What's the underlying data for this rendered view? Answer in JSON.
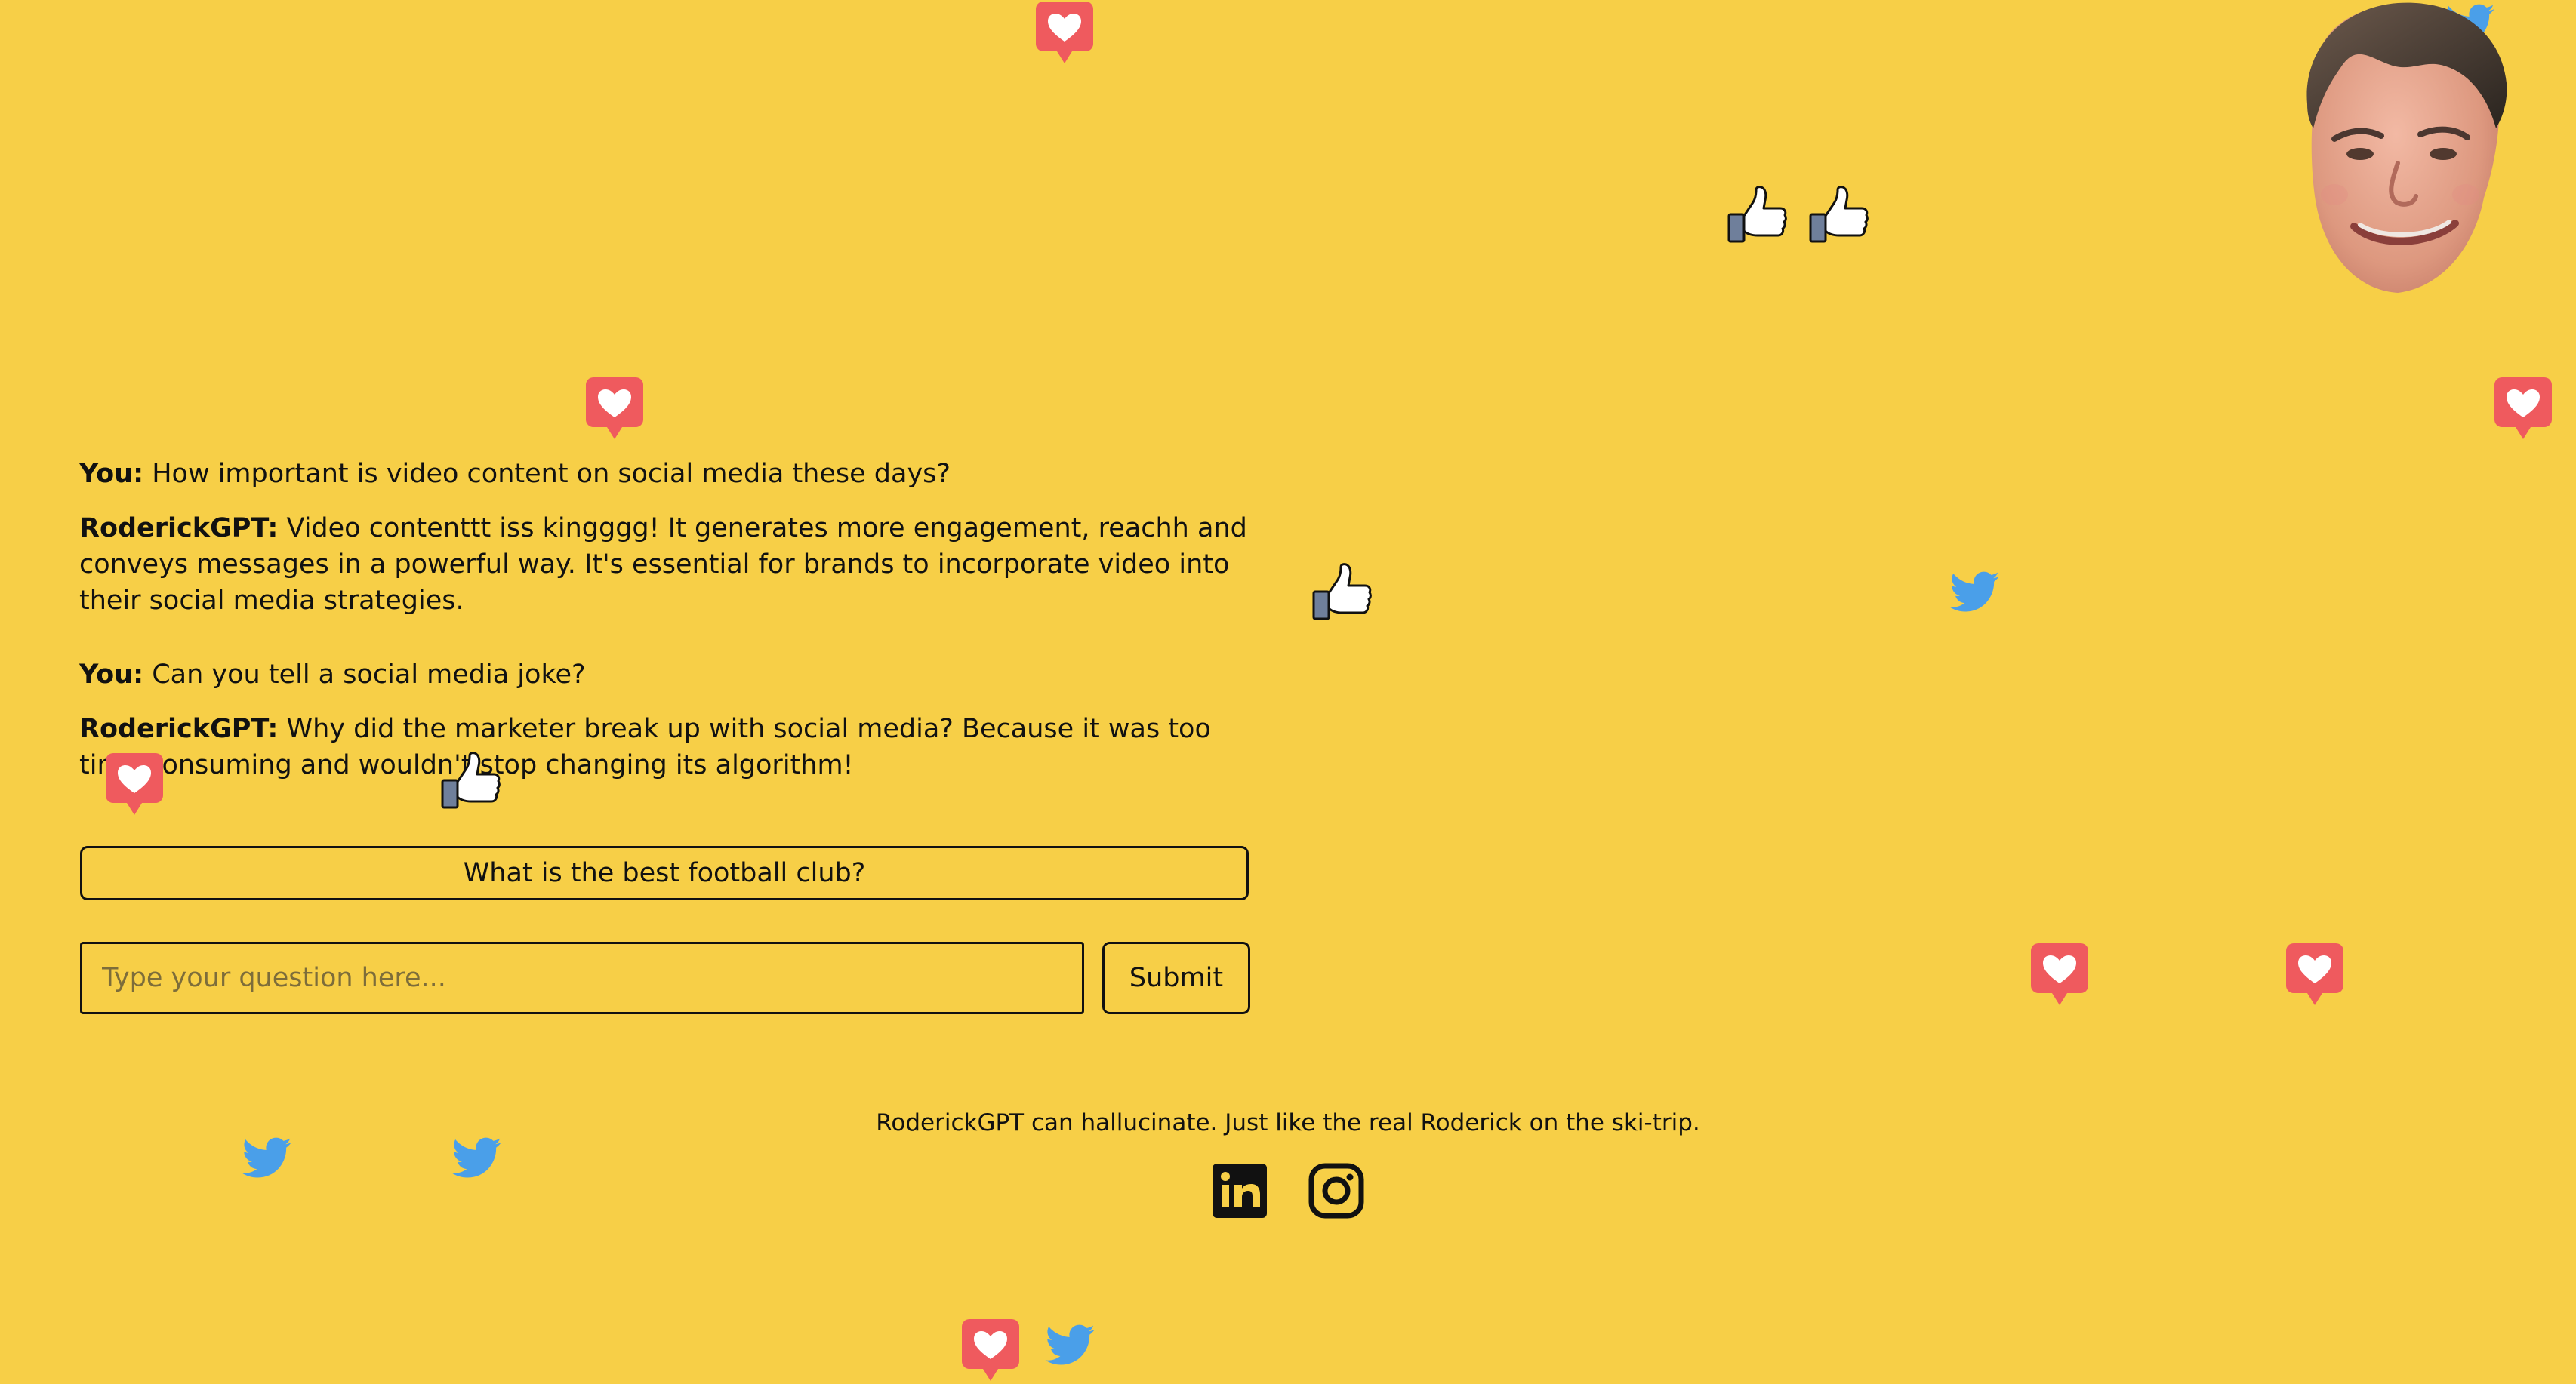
{
  "conversation": {
    "messages": [
      {
        "speaker": "You:",
        "text": " How important is video content on social media these days?"
      },
      {
        "speaker": "RoderickGPT:",
        "text": " Video contenttt iss kingggg! It generates more engagement, reachh and conveys messages in a powerful way. It's essential for brands to incorporate video into their social media strategies."
      },
      {
        "speaker": "You:",
        "text": " Can you tell a social media joke?"
      },
      {
        "speaker": "RoderickGPT:",
        "text": " Why did the marketer break up with social media? Because it was too time consuming and wouldn't stop changing its algorithm!"
      }
    ]
  },
  "suggestion": {
    "label": "What is the best football club?"
  },
  "composer": {
    "placeholder": "Type your question here...",
    "value": "",
    "submit_label": "Submit"
  },
  "footer": {
    "disclaimer": "RoderickGPT can hallucinate. Just like the real Roderick on the ski-trip."
  },
  "icons": {
    "floating": [
      "heart-icon",
      "thumbs-up-icon",
      "twitter-icon"
    ],
    "social": [
      "linkedin-icon",
      "instagram-icon"
    ]
  },
  "colors": {
    "background": "#f7cf47",
    "text": "#111111",
    "heart": "#ef5a5e",
    "twitter": "#4a9fe9",
    "thumb_sleeve": "#6f7f9b"
  }
}
